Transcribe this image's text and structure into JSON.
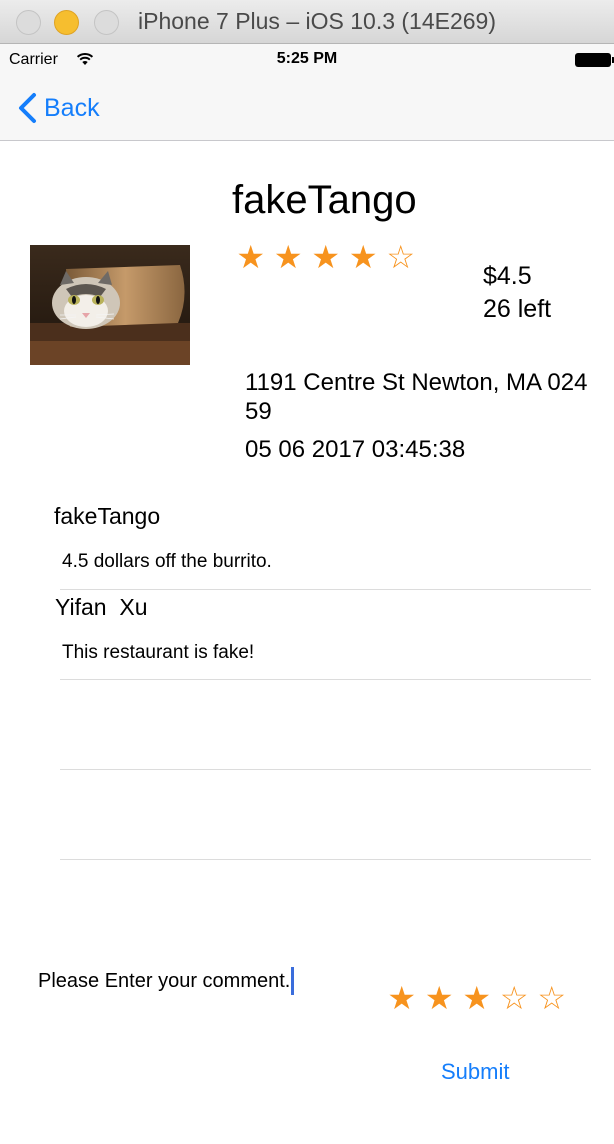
{
  "window": {
    "title": "iPhone 7 Plus – iOS 10.3 (14E269)"
  },
  "status_bar": {
    "carrier": "Carrier",
    "time": "5:25 PM"
  },
  "nav": {
    "back_label": "Back"
  },
  "restaurant": {
    "name": "fakeTango",
    "rating_stars": [
      "★",
      "★",
      "★",
      "★",
      "☆"
    ],
    "price": "$4.5",
    "stock": "26 left",
    "address": "1191 Centre St Newton, MA 02459",
    "datetime": "05 06 2017 03:45:38",
    "image_icon": "cat-in-tortilla-photo"
  },
  "reviews": [
    {
      "author": "fakeTango",
      "text": "4.5 dollars off the burrito."
    },
    {
      "author": "Yifan  Xu",
      "text": "This restaurant is fake!"
    }
  ],
  "comment": {
    "value": "Please Enter your comment.",
    "user_stars": [
      "★",
      "★",
      "★",
      "☆",
      "☆"
    ],
    "submit_label": "Submit"
  },
  "colors": {
    "accent": "#157efb",
    "star": "#f7931e"
  }
}
